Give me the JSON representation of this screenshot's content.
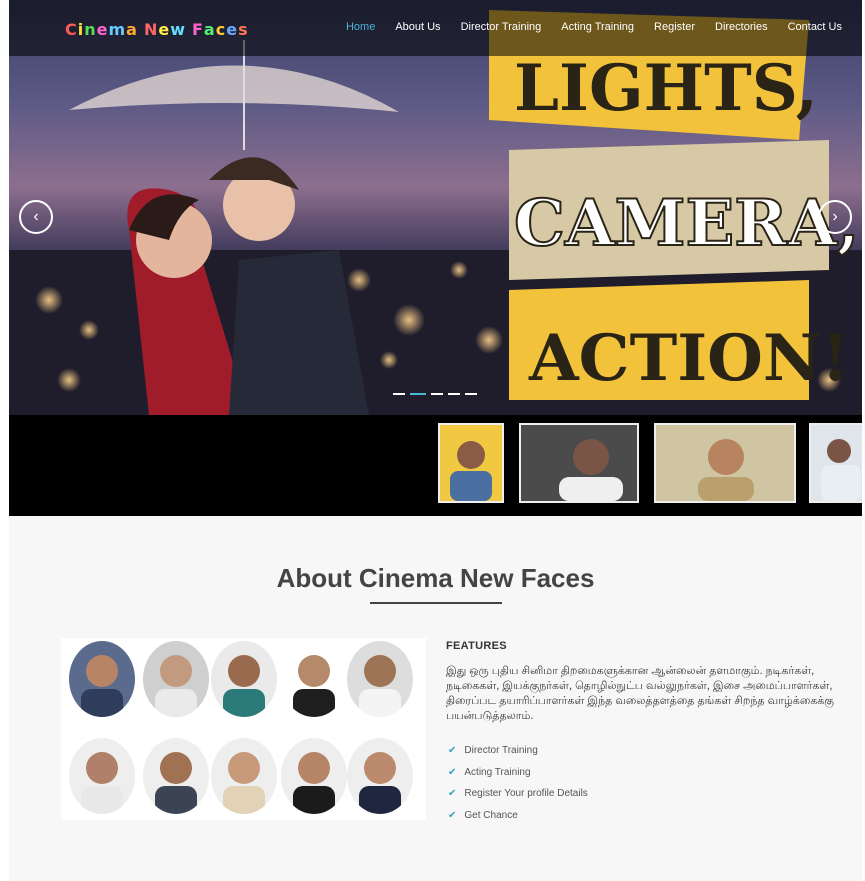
{
  "header": {
    "logo": {
      "letters": [
        {
          "ch": "C",
          "color": "#ff5a5a"
        },
        {
          "ch": "i",
          "color": "#ffdd33"
        },
        {
          "ch": "n",
          "color": "#55dd55"
        },
        {
          "ch": "e",
          "color": "#ff66cc"
        },
        {
          "ch": "m",
          "color": "#66ccff"
        },
        {
          "ch": "a",
          "color": "#ffaa33"
        },
        {
          "ch": " ",
          "color": "#ffffff"
        },
        {
          "ch": "N",
          "color": "#ff6666"
        },
        {
          "ch": "e",
          "color": "#ffee44"
        },
        {
          "ch": "w",
          "color": "#66ddff"
        },
        {
          "ch": " ",
          "color": "#ffffff"
        },
        {
          "ch": "F",
          "color": "#ff66cc"
        },
        {
          "ch": "a",
          "color": "#55ee77"
        },
        {
          "ch": "c",
          "color": "#ffcc33"
        },
        {
          "ch": "e",
          "color": "#66aaff"
        },
        {
          "ch": "s",
          "color": "#ff7755"
        }
      ]
    },
    "nav": [
      {
        "label": "Home",
        "active": true
      },
      {
        "label": "About Us",
        "active": false
      },
      {
        "label": "Director Training",
        "active": false
      },
      {
        "label": "Acting Training",
        "active": false
      },
      {
        "label": "Register",
        "active": false
      },
      {
        "label": "Directories",
        "active": false
      },
      {
        "label": "Contact Us",
        "active": false
      }
    ]
  },
  "slider": {
    "prev_icon": "chevron-left-icon",
    "next_icon": "chevron-right-icon",
    "prev_glyph": "‹",
    "next_glyph": "›",
    "banner_lines": [
      "LIGHTS,",
      "CAMERA,",
      "ACTION!"
    ],
    "slide_count": 5,
    "active_slide": 2,
    "accent_color": "#4bb6d6"
  },
  "about": {
    "title": "About Cinema New Faces",
    "features_heading": "FEATURES",
    "description": "இது ஒரு புதிய சினிமா திறமைகளுக்கான ஆன்லைன் தளமாகும். நடிகர்கள், நடிகைகள், இயக்குநர்கள், தொழில்நுட்ப வல்லுநர்கள், இசை அமைப்பாளர்கள், திரைப்பட தயாரிப்பாளர்கள் இந்த வலைத்தளத்தை தங்கள் சிறந்த வாழ்க்கைக்கு பயன்படுத்தலாம்.",
    "features": [
      "Director Training",
      "Acting Training",
      "Register Your profile Details",
      "Get Chance"
    ],
    "check_color": "#3aa0c8"
  }
}
